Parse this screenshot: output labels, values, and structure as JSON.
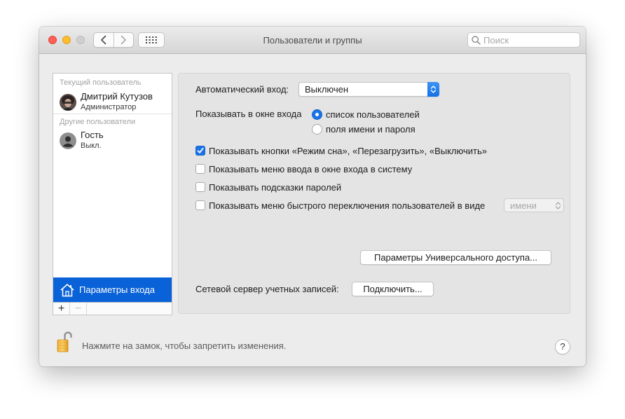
{
  "window": {
    "title": "Пользователи и группы"
  },
  "search": {
    "placeholder": "Поиск"
  },
  "sidebar": {
    "current_user_section": "Текущий пользователь",
    "current_user": {
      "name": "Дмитрий Кутузов",
      "role": "Администратор",
      "avatar_icon": "user-photo-avatar"
    },
    "other_users_section": "Другие пользователи",
    "other_users": [
      {
        "name": "Гость",
        "status": "Выкл.",
        "avatar_icon": "generic-user-icon"
      }
    ],
    "login_options": {
      "label": "Параметры входа",
      "icon": "house-icon"
    },
    "add_button": "+",
    "remove_button": "−"
  },
  "login_options_panel": {
    "auto_login_label": "Автоматический вход:",
    "auto_login_value": "Выключен",
    "display_label": "Показывать в окне входа",
    "display_options": [
      {
        "label": "список пользователей",
        "selected": true
      },
      {
        "label": "поля имени и пароля",
        "selected": false
      }
    ],
    "checkboxes": [
      {
        "label": "Показывать кнопки «Режим сна», «Перезагрузить», «Выключить»",
        "checked": true
      },
      {
        "label": "Показывать меню ввода в окне входа в систему",
        "checked": false
      },
      {
        "label": "Показывать подсказки паролей",
        "checked": false
      },
      {
        "label": "Показывать меню быстрого переключения пользователей в виде",
        "checked": false
      }
    ],
    "fast_switch_value": "имени",
    "accessibility_button": "Параметры Универсального доступа...",
    "network_server_label": "Сетевой сервер учетных записей:",
    "connect_button": "Подключить..."
  },
  "footer": {
    "lock_text": "Нажмите на замок, чтобы запретить изменения.",
    "help_label": "?"
  },
  "colors": {
    "accent": "#1a73e8",
    "selection": "#0a62d8",
    "close": "#fe5f57",
    "minimize": "#febc2e"
  }
}
